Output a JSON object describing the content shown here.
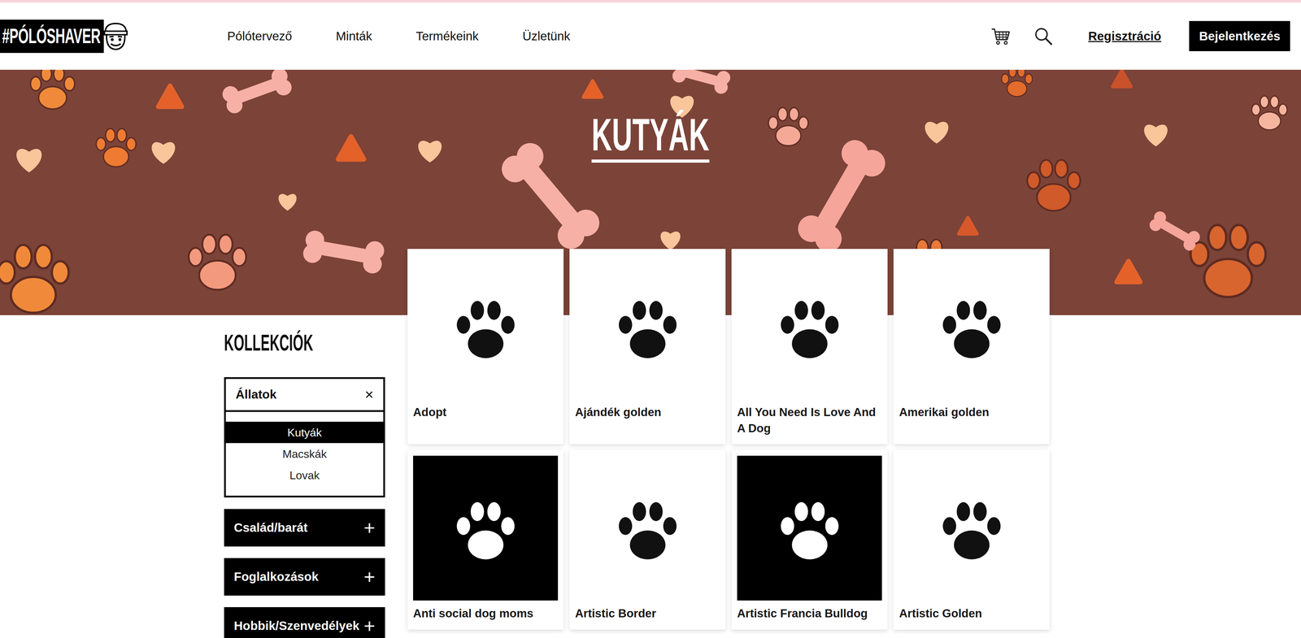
{
  "logo": {
    "text": "#PÓLÓSHAVER"
  },
  "nav": [
    {
      "label": "Pólótervező"
    },
    {
      "label": "Minták"
    },
    {
      "label": "Termékeink"
    },
    {
      "label": "Üzletünk"
    }
  ],
  "actions": {
    "register": "Regisztráció",
    "login": "Bejelentkezés"
  },
  "banner": {
    "title": "KUTYÁK"
  },
  "sidebar": {
    "title": "KOLLEKCIÓK",
    "filter": {
      "label": "Állatok",
      "clear": "×",
      "expanded": true
    },
    "items": [
      {
        "label": "Kutyák",
        "selected": true
      },
      {
        "label": "Macskák",
        "selected": false
      },
      {
        "label": "Lovak",
        "selected": false
      }
    ],
    "groups": [
      {
        "label": "Család/barát",
        "toggle": "+",
        "expanded": false
      },
      {
        "label": "Foglalkozások",
        "toggle": "+",
        "expanded": false
      },
      {
        "label": "Hobbik/Szenvedélyek",
        "toggle": "+",
        "expanded": false
      }
    ]
  },
  "products": [
    {
      "name": "Adopt",
      "kind": "light"
    },
    {
      "name": "Ajándék golden",
      "kind": "light"
    },
    {
      "name": "All You Need Is Love And A Dog",
      "kind": "light"
    },
    {
      "name": "Amerikai golden",
      "kind": "light"
    },
    {
      "name": "Anti social dog moms",
      "kind": "dark"
    },
    {
      "name": "Artistic Border",
      "kind": "light"
    },
    {
      "name": "Artistic Francia Bulldog",
      "kind": "dark"
    },
    {
      "name": "Artistic Golden",
      "kind": "light"
    }
  ]
}
